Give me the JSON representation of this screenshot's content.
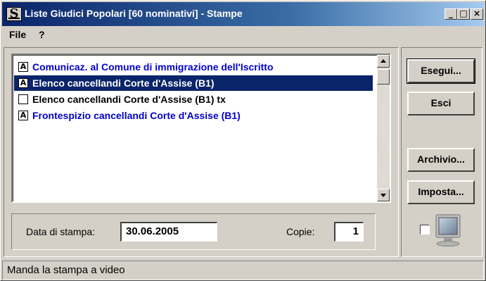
{
  "window": {
    "title": "Liste Giudici Popolari [60 nominativi] - Stampe",
    "app_icon_letter": "S",
    "minimize_symbol": "_",
    "maximize_symbol": "□",
    "close_symbol": "×"
  },
  "menu": {
    "items": [
      "File",
      "?"
    ]
  },
  "list": {
    "items": [
      {
        "label": "Comunicaz. al Comune di immigrazione dell'Iscritto",
        "icon": "A",
        "color": "blue",
        "selected": false
      },
      {
        "label": "Elenco cancellandi Corte d'Assise (B1)",
        "icon": "A",
        "color": "white",
        "selected": true
      },
      {
        "label": "Elenco cancellandi Corte d'Assise (B1) tx",
        "icon": "",
        "color": "black",
        "selected": false
      },
      {
        "label": "Frontespizio cancellandi Corte d'Assise (B1)",
        "icon": "A",
        "color": "blue",
        "selected": false
      }
    ]
  },
  "print_options": {
    "date_label": "Data di stampa:",
    "date_value": "30.06.2005",
    "copies_label": "Copie:",
    "copies_value": "1"
  },
  "buttons": {
    "esegui": "Esegui...",
    "esci": "Esci",
    "archivio": "Archivio...",
    "imposta": "Imposta..."
  },
  "preview_checkbox": {
    "checked": false,
    "icon": "monitor-icon"
  },
  "status": {
    "text": "Manda la stampa a video"
  },
  "colors": {
    "selection": "#0a246a",
    "link_blue": "#0000cc",
    "face": "#d4d0c8"
  }
}
